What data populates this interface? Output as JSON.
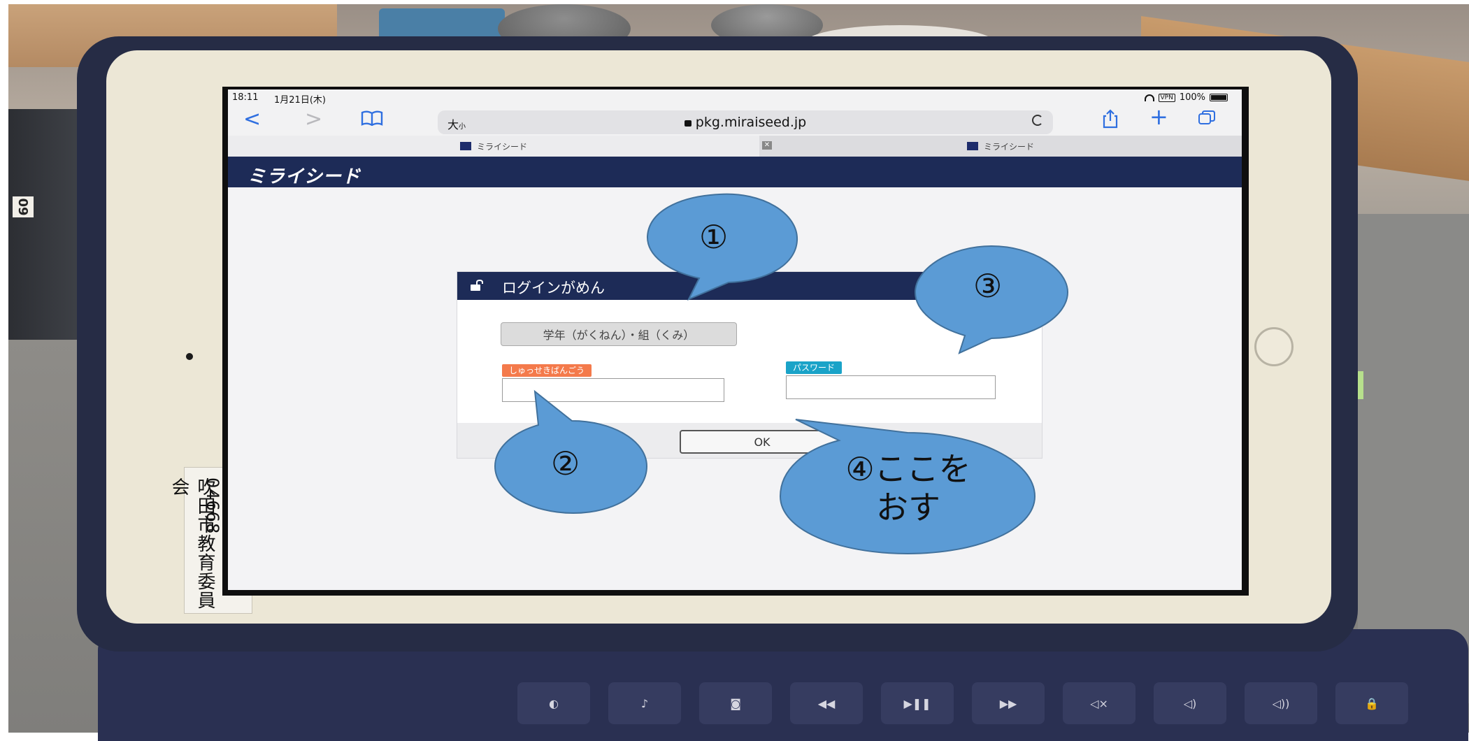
{
  "status_bar": {
    "time": "18:11",
    "date": "1月21日(木)",
    "battery": "100%",
    "vpn": "VPN"
  },
  "browser": {
    "text_size_big": "大",
    "text_size_small": "小",
    "url": "pkg.miraiseed.jp",
    "tabs": [
      {
        "title": "ミライシード"
      },
      {
        "title": "ミライシード"
      }
    ],
    "tab_close": "✕"
  },
  "site": {
    "logo": "ミライシード"
  },
  "login": {
    "title": "ログインがめん",
    "class_select": "学年（がくねん）・組（くみ）",
    "number_label": "しゅっせきばんごう",
    "password_label": "パスワード",
    "ok": "OK"
  },
  "callouts": {
    "one": "①",
    "two": "②",
    "three": "③",
    "four_line1": "④ここを",
    "four_line2": "おす"
  },
  "asset_label": {
    "line1": "吹田市教育委員会",
    "line2": "GA20S09-04668"
  },
  "folder_label": "09",
  "colors": {
    "callout_fill": "#5b9bd5",
    "callout_stroke": "#41719c",
    "header_navy": "#1d2b57"
  }
}
